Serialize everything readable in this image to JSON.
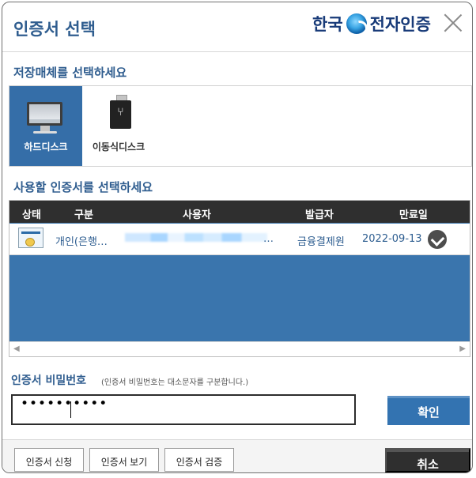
{
  "dialog": {
    "title": "인증서 선택",
    "brand": "한국 전자인증"
  },
  "storage": {
    "label": "저장매체를 선택하세요",
    "items": [
      {
        "label": "하드디스크",
        "icon": "monitor-icon",
        "selected": true
      },
      {
        "label": "이동식디스크",
        "icon": "usb-drive-icon",
        "selected": false
      }
    ]
  },
  "certificates": {
    "label": "사용할 인증서를 선택하세요",
    "columns": [
      "상태",
      "구분",
      "사용자",
      "발급자",
      "만료일"
    ],
    "rows": [
      {
        "type": "개인(은행…",
        "user_suffix": "…",
        "issuer": "금융결제원",
        "expires": "2022-09-13",
        "status_icon": "certificate-icon",
        "selected_icon": "check-circle-icon"
      }
    ]
  },
  "password": {
    "label": "인증서 비밀번호",
    "hint": "(인증서 비밀번호는 대소문자를 구분합니다.)",
    "value": "••••••••••"
  },
  "buttons": {
    "confirm": "확인",
    "cancel": "취소",
    "apply": "인증서 신청",
    "view": "인증서 보기",
    "verify": "인증서 검증"
  }
}
